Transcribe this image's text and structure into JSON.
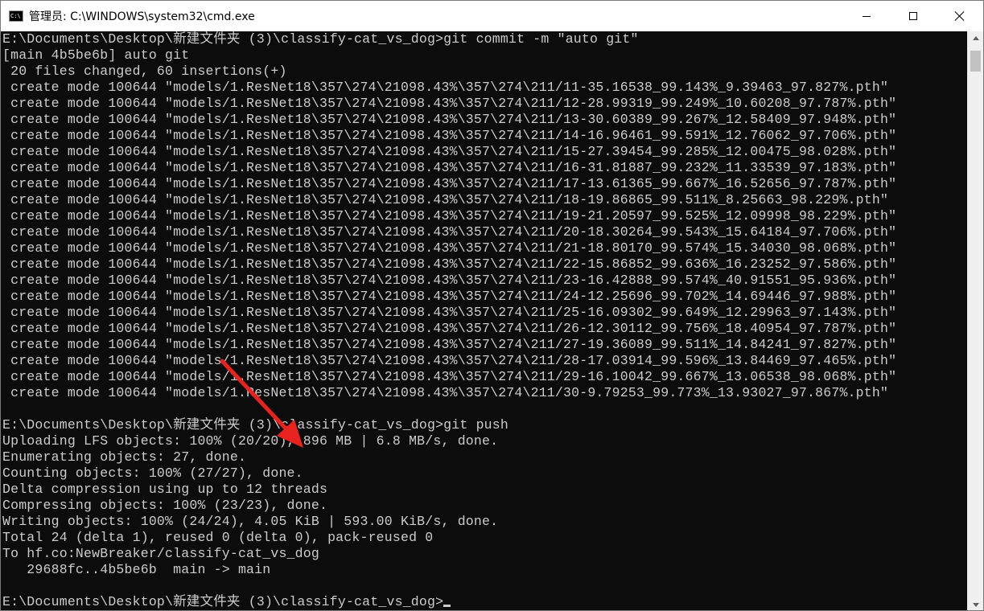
{
  "window": {
    "title": "管理员: C:\\WINDOWS\\system32\\cmd.exe",
    "app_icon": "cmd-icon",
    "controls": [
      "minimize-icon",
      "maximize-icon",
      "close-icon"
    ]
  },
  "console": {
    "lines": [
      "E:\\Documents\\Desktop\\新建文件夹 (3)\\classify-cat_vs_dog>git commit -m \"auto git\"",
      "[main 4b5be6b] auto git",
      " 20 files changed, 60 insertions(+)",
      " create mode 100644 \"models/1.ResNet18\\357\\274\\21098.43%\\357\\274\\211/11-35.16538_99.143%_9.39463_97.827%.pth\"",
      " create mode 100644 \"models/1.ResNet18\\357\\274\\21098.43%\\357\\274\\211/12-28.99319_99.249%_10.60208_97.787%.pth\"",
      " create mode 100644 \"models/1.ResNet18\\357\\274\\21098.43%\\357\\274\\211/13-30.60389_99.267%_12.58409_97.948%.pth\"",
      " create mode 100644 \"models/1.ResNet18\\357\\274\\21098.43%\\357\\274\\211/14-16.96461_99.591%_12.76062_97.706%.pth\"",
      " create mode 100644 \"models/1.ResNet18\\357\\274\\21098.43%\\357\\274\\211/15-27.39454_99.285%_12.00475_98.028%.pth\"",
      " create mode 100644 \"models/1.ResNet18\\357\\274\\21098.43%\\357\\274\\211/16-31.81887_99.232%_11.33539_97.183%.pth\"",
      " create mode 100644 \"models/1.ResNet18\\357\\274\\21098.43%\\357\\274\\211/17-13.61365_99.667%_16.52656_97.787%.pth\"",
      " create mode 100644 \"models/1.ResNet18\\357\\274\\21098.43%\\357\\274\\211/18-19.86865_99.511%_8.25663_98.229%.pth\"",
      " create mode 100644 \"models/1.ResNet18\\357\\274\\21098.43%\\357\\274\\211/19-21.20597_99.525%_12.09998_98.229%.pth\"",
      " create mode 100644 \"models/1.ResNet18\\357\\274\\21098.43%\\357\\274\\211/20-18.30264_99.543%_15.64184_97.706%.pth\"",
      " create mode 100644 \"models/1.ResNet18\\357\\274\\21098.43%\\357\\274\\211/21-18.80170_99.574%_15.34030_98.068%.pth\"",
      " create mode 100644 \"models/1.ResNet18\\357\\274\\21098.43%\\357\\274\\211/22-15.86852_99.636%_16.23252_97.586%.pth\"",
      " create mode 100644 \"models/1.ResNet18\\357\\274\\21098.43%\\357\\274\\211/23-16.42888_99.574%_40.91551_95.936%.pth\"",
      " create mode 100644 \"models/1.ResNet18\\357\\274\\21098.43%\\357\\274\\211/24-12.25696_99.702%_14.69446_97.988%.pth\"",
      " create mode 100644 \"models/1.ResNet18\\357\\274\\21098.43%\\357\\274\\211/25-16.09302_99.649%_12.29963_97.143%.pth\"",
      " create mode 100644 \"models/1.ResNet18\\357\\274\\21098.43%\\357\\274\\211/26-12.30112_99.756%_18.40954_97.787%.pth\"",
      " create mode 100644 \"models/1.ResNet18\\357\\274\\21098.43%\\357\\274\\211/27-19.36089_99.511%_14.84241_97.827%.pth\"",
      " create mode 100644 \"models/1.ResNet18\\357\\274\\21098.43%\\357\\274\\211/28-17.03914_99.596%_13.84469_97.465%.pth\"",
      " create mode 100644 \"models/1.ResNet18\\357\\274\\21098.43%\\357\\274\\211/29-16.10042_99.667%_13.06538_98.068%.pth\"",
      " create mode 100644 \"models/1.ResNet18\\357\\274\\21098.43%\\357\\274\\211/30-9.79253_99.773%_13.93027_97.867%.pth\"",
      "",
      "E:\\Documents\\Desktop\\新建文件夹 (3)\\classify-cat_vs_dog>git push",
      "Uploading LFS objects: 100% (20/20), 896 MB | 6.8 MB/s, done.",
      "Enumerating objects: 27, done.",
      "Counting objects: 100% (27/27), done.",
      "Delta compression using up to 12 threads",
      "Compressing objects: 100% (23/23), done.",
      "Writing objects: 100% (24/24), 4.05 KiB | 593.00 KiB/s, done.",
      "Total 24 (delta 1), reused 0 (delta 0), pack-reused 0",
      "To hf.co:NewBreaker/classify-cat_vs_dog",
      "   29688fc..4b5be6b  main -> main",
      "",
      "E:\\Documents\\Desktop\\新建文件夹 (3)\\classify-cat_vs_dog>"
    ]
  },
  "colors": {
    "console_bg": "#0c0c0c",
    "console_fg": "#cccccc",
    "arrow": "#e8231f"
  }
}
